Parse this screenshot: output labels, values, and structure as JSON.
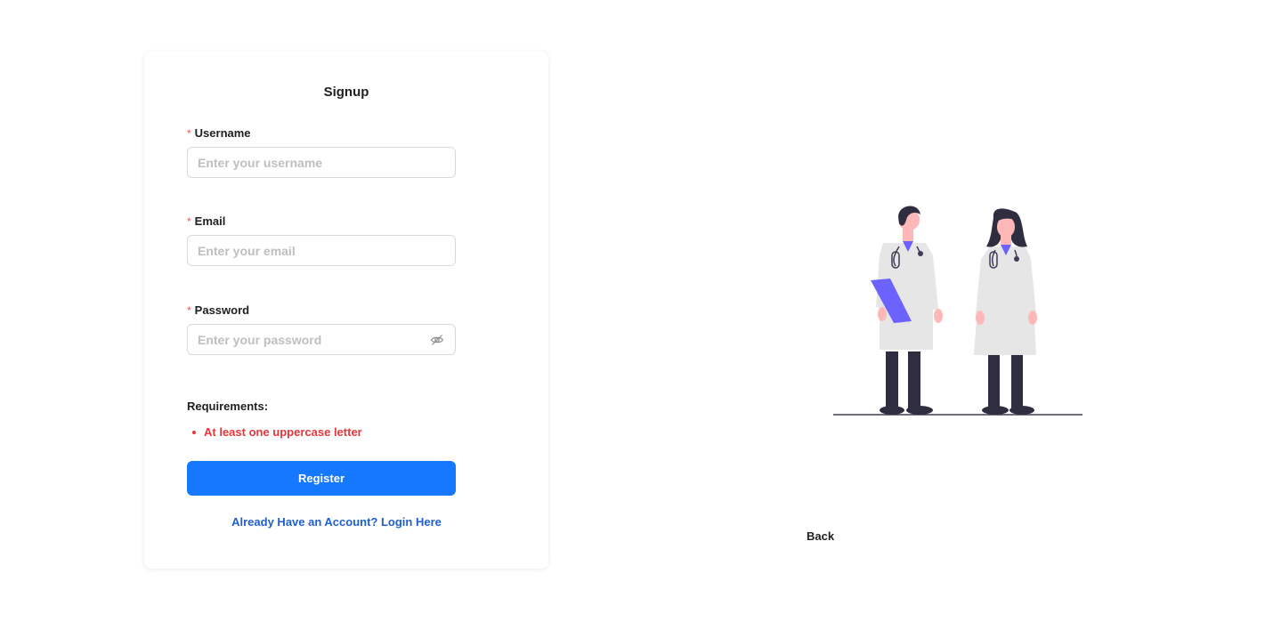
{
  "form": {
    "title": "Signup",
    "username": {
      "label": "Username",
      "required_mark": "*",
      "placeholder": "Enter your username",
      "value": ""
    },
    "email": {
      "label": "Email",
      "required_mark": "*",
      "placeholder": "Enter your email",
      "value": ""
    },
    "password": {
      "label": "Password",
      "required_mark": "*",
      "placeholder": "Enter your password",
      "value": "",
      "toggle_icon": "eye-invisible-icon"
    },
    "requirements": {
      "title": "Requirements:",
      "items": [
        "At least one uppercase letter"
      ]
    },
    "register_label": "Register",
    "login_link": "Already Have an Account? Login Here"
  },
  "back_label": "Back",
  "illustration": {
    "icon": "doctors-illustration"
  },
  "colors": {
    "primary": "#1677ff",
    "link": "#1f5fcf",
    "error": "#e5383b",
    "required": "#ff4d4f",
    "accent_purple": "#6c63ff"
  }
}
